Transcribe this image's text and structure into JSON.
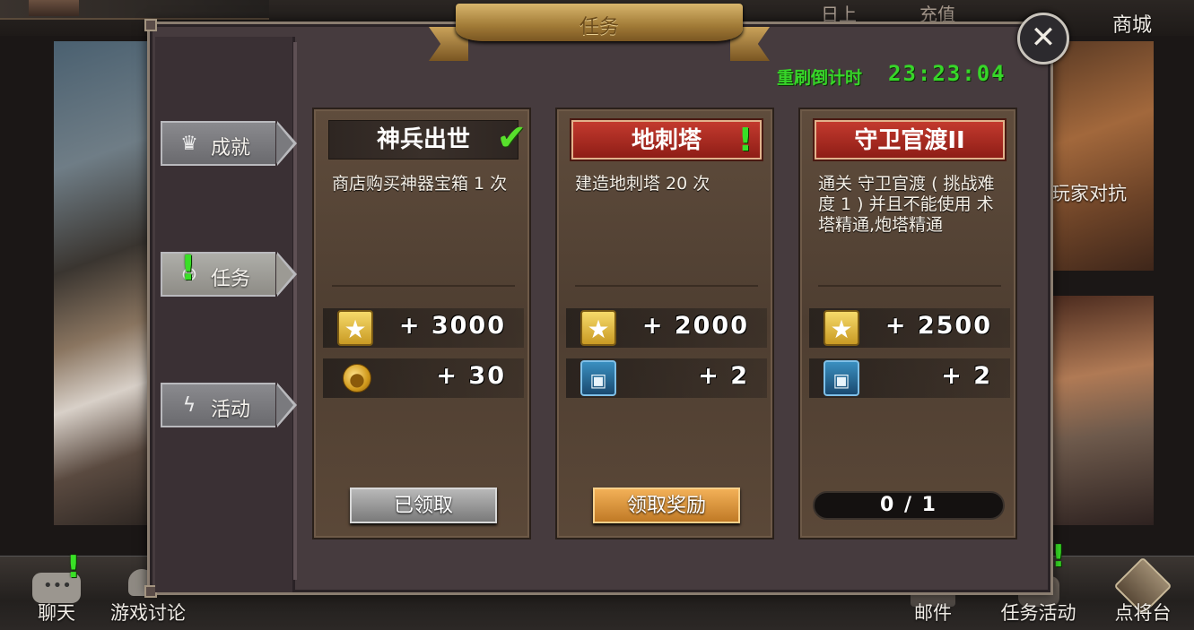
{
  "header": {
    "title": "任务",
    "close_label": "✕",
    "refresh_label": "重刷倒计时",
    "refresh_countdown": "23:23:04"
  },
  "background": {
    "top_tabs": [
      "日上",
      "充值"
    ],
    "shop_label": "商城",
    "pvp_label": "玩家对抗"
  },
  "sidebar": {
    "items": [
      {
        "label": "成就",
        "icon": "crown-icon",
        "active": false,
        "alert": false
      },
      {
        "label": "任务",
        "icon": "scroll-icon",
        "active": true,
        "alert": true
      },
      {
        "label": "活动",
        "icon": "lightning-icon",
        "active": false,
        "alert": false
      }
    ]
  },
  "quests": [
    {
      "title": "神兵出世",
      "title_style": "plain",
      "status_icon": "check-icon",
      "description": "商店购买神器宝箱 1 次",
      "rewards": [
        {
          "icon": "star-icon",
          "amount": "+ 3000"
        },
        {
          "icon": "coin-icon",
          "amount": "+ 30"
        }
      ],
      "action": "已领取",
      "action_state": "claimed"
    },
    {
      "title": "地刺塔",
      "title_style": "red",
      "status_icon": "exclamation-icon",
      "description": "建造地刺塔 20 次",
      "rewards": [
        {
          "icon": "star-icon",
          "amount": "+ 2000"
        },
        {
          "icon": "card-icon",
          "amount": "+ 2"
        }
      ],
      "action": "领取奖励",
      "action_state": "claim"
    },
    {
      "title": "守卫官渡II",
      "title_style": "red",
      "status_icon": "",
      "description": "通关 守卫官渡 ( 挑战难度 1 ) 并且不能使用 术塔精通,炮塔精通",
      "rewards": [
        {
          "icon": "star-icon",
          "amount": "+ 2500"
        },
        {
          "icon": "card-icon",
          "amount": "+ 2"
        }
      ],
      "progress_text": "0 / 1",
      "progress_fraction": 0,
      "action_state": "in-progress"
    }
  ],
  "bottom_bar": {
    "items": [
      {
        "label": "聊天",
        "icon": "chat-icon"
      },
      {
        "label": "游戏讨论",
        "icon": "forum-icon"
      },
      {
        "label": "邮件",
        "icon": "mail-icon"
      },
      {
        "label": "任务活动",
        "icon": "quest-icon"
      },
      {
        "label": "点将台",
        "icon": "general-icon"
      }
    ]
  },
  "colors": {
    "accent_green": "#37d629",
    "claim_orange": "#d8913a",
    "title_red": "#b02c22"
  }
}
